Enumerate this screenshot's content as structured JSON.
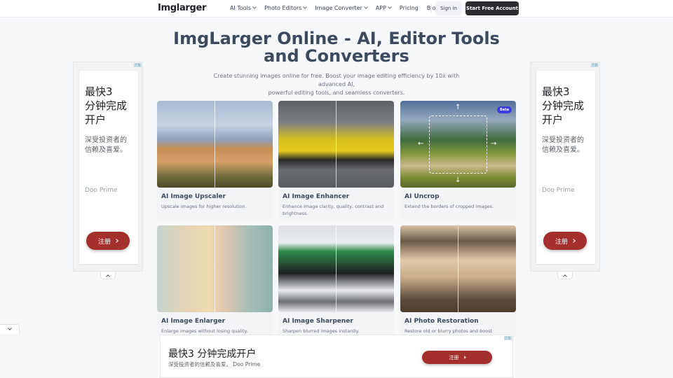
{
  "nav": {
    "logo": "Imglarger",
    "menu": [
      {
        "label": "AI Tools",
        "dropdown": true
      },
      {
        "label": "Photo Editors",
        "dropdown": true
      },
      {
        "label": "Image Converter",
        "dropdown": true
      },
      {
        "label": "APP",
        "dropdown": true
      },
      {
        "label": "Pricing",
        "dropdown": false
      },
      {
        "label": "Blog",
        "dropdown": false
      }
    ],
    "sign_in": "Sign in",
    "start_free": "Start Free Account"
  },
  "hero": {
    "title_line1": "ImgLarger Online - AI, Editor Tools",
    "title_line2": "and Converters",
    "subtitle_line1": "Create stunning images online for free. Boost your image editing efficiency by 10x with advanced AI,",
    "subtitle_line2": "powerful editing tools, and seamless converters."
  },
  "cards": [
    {
      "title": "AI Image Upscaler",
      "desc": "Upscale images for higher resolution.",
      "image": "church-volcano-before-after"
    },
    {
      "title": "AI Image Enhancer",
      "desc": "Enhance image clarity, quality, contrast and brightness.",
      "image": "race-car-before-after"
    },
    {
      "title": "AI Uncrop",
      "desc": "Extend the borders of cropped images.",
      "image": "starry-landscape-uncrop",
      "badge": "Beta"
    },
    {
      "title": "AI Image Enlarger",
      "desc": "Enlarge images without losing quality.",
      "image": "blonde-portrait-before-after"
    },
    {
      "title": "AI Image Sharpener",
      "desc": "Sharpen blurred images instantly.",
      "image": "skier-before-after"
    },
    {
      "title": "AI Photo Restoration",
      "desc": "Restore old or blurry photos and boost",
      "image": "old-man-portrait-before-after"
    }
  ],
  "side_ad": {
    "badge": "广告",
    "headline_line1": "最快3",
    "headline_line2": "分钟完成",
    "headline_line3": "开户",
    "desc_line1": "深受投资者的",
    "desc_line2": "信赖及喜爱。",
    "brand": "Doo Prime",
    "cta": "注册"
  },
  "bottom_ad": {
    "badge": "广告",
    "headline": "最快3 分钟完成开户",
    "desc": "深受投资者的信赖及喜爱。 Doo Prime",
    "cta": "注册"
  },
  "colors": {
    "accent_dark": "#2b2d31",
    "ad_cta": "#a3302d",
    "beta_badge": "#3b3de0",
    "heading": "#3d4a5e"
  }
}
